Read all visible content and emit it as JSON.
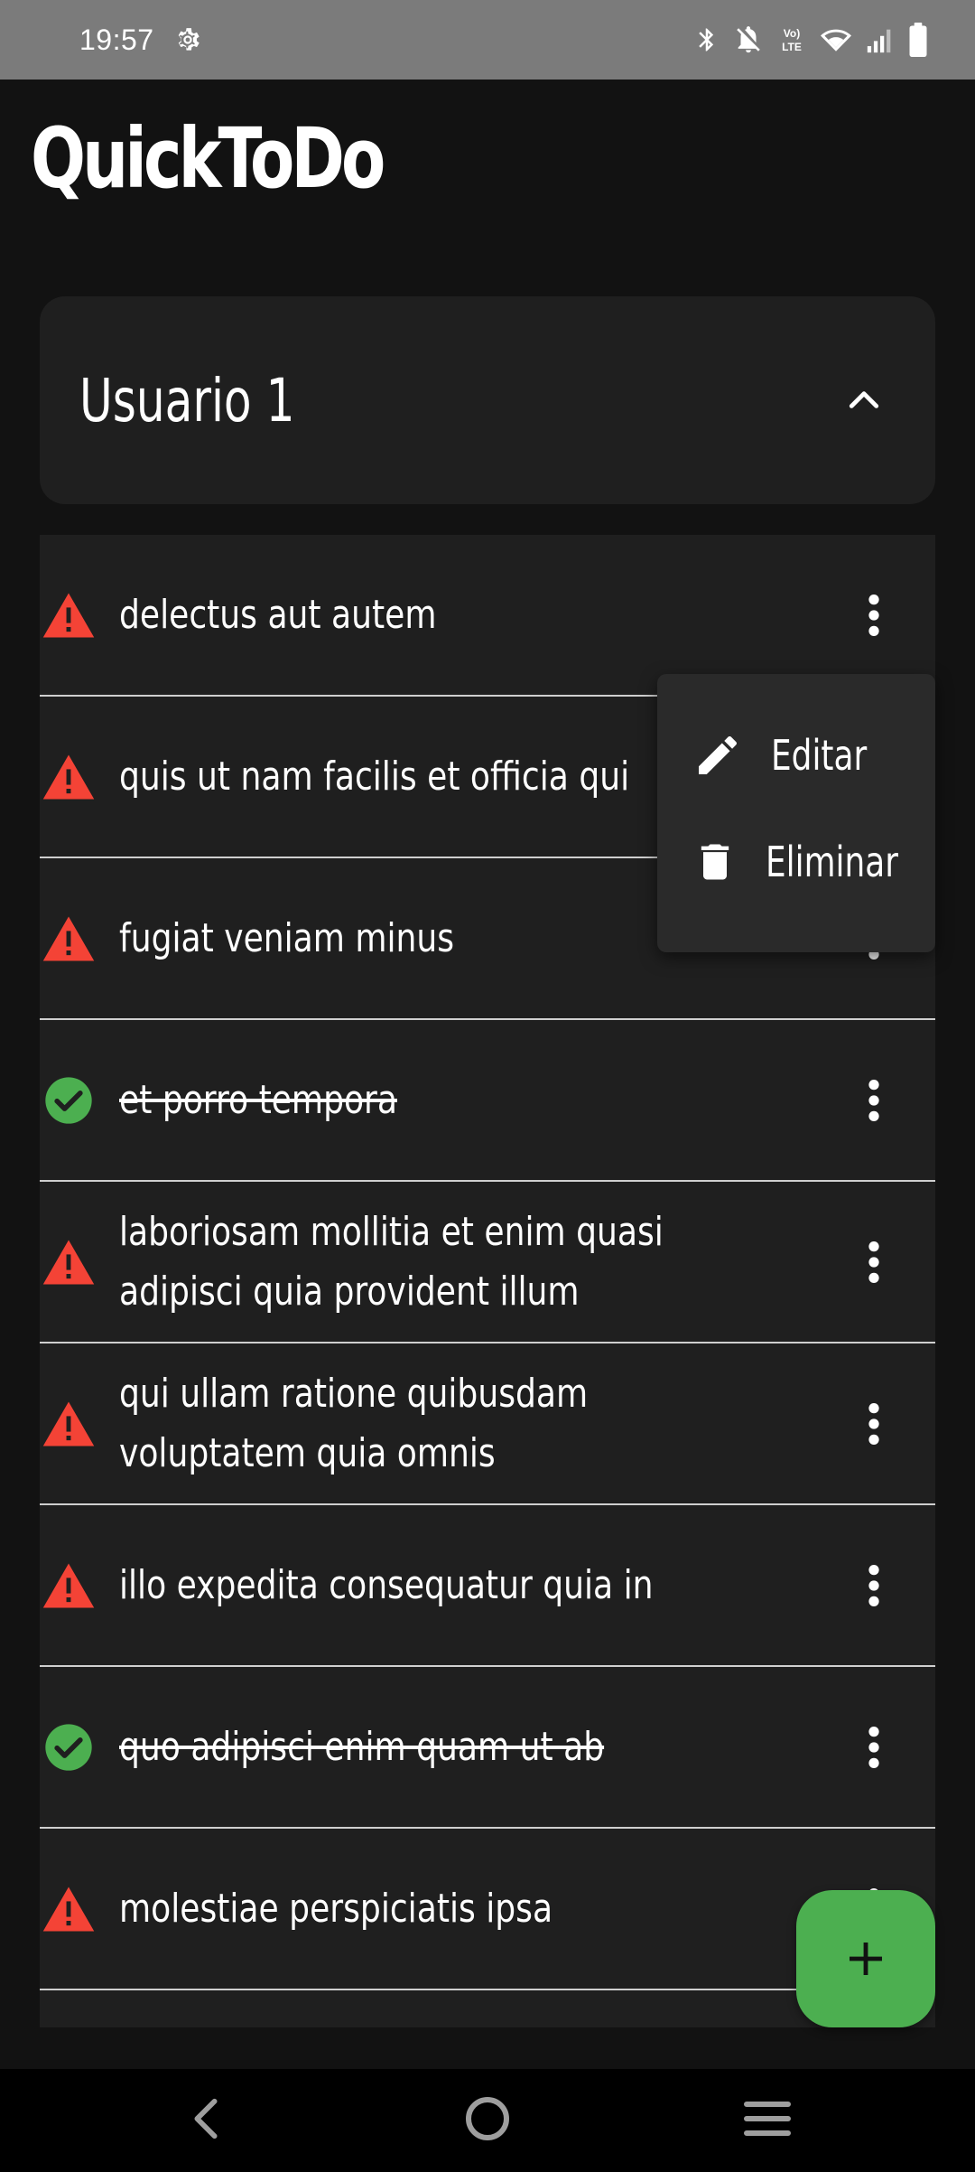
{
  "status_bar": {
    "time": "19:57",
    "icons": [
      "settings-icon",
      "bluetooth-icon",
      "notifications-off-icon",
      "volte-icon",
      "wifi-icon",
      "signal-icon",
      "battery-icon"
    ],
    "background": "#7b7b7b"
  },
  "app": {
    "title": "QuickToDo"
  },
  "user_card": {
    "name": "Usuario 1",
    "expanded": true
  },
  "todos": [
    {
      "text": "delectus aut autem",
      "completed": false
    },
    {
      "text": "quis ut nam facilis et officia qui",
      "completed": false
    },
    {
      "text": "fugiat veniam minus",
      "completed": false
    },
    {
      "text": "et porro tempora",
      "completed": true
    },
    {
      "text": "laboriosam mollitia et enim quasi adipisci quia provident illum",
      "completed": false
    },
    {
      "text": "qui ullam ratione quibusdam voluptatem quia omnis",
      "completed": false
    },
    {
      "text": "illo expedita consequatur quia in",
      "completed": false
    },
    {
      "text": "quo adipisci enim quam ut ab",
      "completed": true
    },
    {
      "text": "molestiae perspiciatis ipsa",
      "completed": false
    }
  ],
  "popup_menu": {
    "edit_label": "Editar",
    "delete_label": "Eliminar"
  },
  "fab": {
    "icon": "plus-icon"
  },
  "colors": {
    "warning": "#f44336",
    "done": "#4caf50",
    "surface": "#1f1f1f",
    "background": "#121212"
  }
}
